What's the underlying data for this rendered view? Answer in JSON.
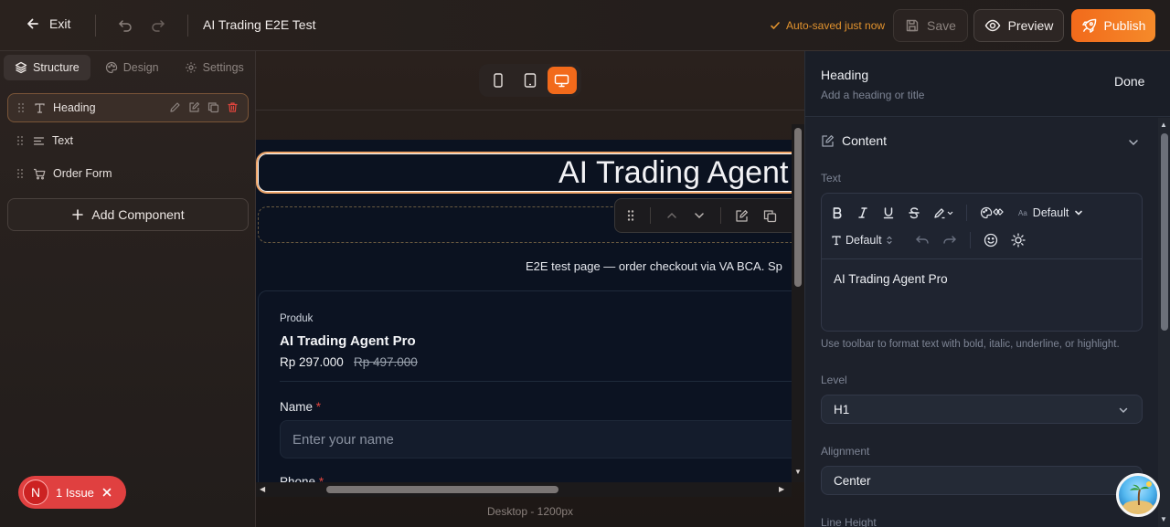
{
  "topbar": {
    "exit_label": "Exit",
    "title": "AI Trading E2E Test",
    "autosave": "Auto-saved just now",
    "save_label": "Save",
    "preview_label": "Preview",
    "publish_label": "Publish"
  },
  "left": {
    "tabs": [
      {
        "label": "Structure",
        "icon": "layers-icon",
        "active": true
      },
      {
        "label": "Design",
        "icon": "palette-icon"
      },
      {
        "label": "Settings",
        "icon": "gear-icon"
      }
    ],
    "components": [
      {
        "label": "Heading",
        "icon": "text-type-icon",
        "selected": true
      },
      {
        "label": "Text",
        "icon": "align-left-icon"
      },
      {
        "label": "Order Form",
        "icon": "cart-icon"
      }
    ],
    "add_label": "Add Component",
    "issue": {
      "avatar": "N",
      "label": "1 Issue"
    }
  },
  "canvas": {
    "devices": [
      "mobile",
      "tablet",
      "desktop"
    ],
    "active_device": "desktop",
    "heading_text": "AI Trading Agent Pro",
    "subtitle": "E2E test page — order checkout via VA BCA. Sp",
    "product_caption": "Produk",
    "product_name": "AI Trading Agent Pro",
    "price": "Rp 297.000",
    "old_price": "Rp 497.000",
    "name_label": "Name",
    "name_placeholder": "Enter your name",
    "phone_label": "Phone",
    "required_mark": "*",
    "caption": "Desktop - 1200px"
  },
  "right": {
    "title": "Heading",
    "subtitle": "Add a heading or title",
    "done_label": "Done",
    "section_label": "Content",
    "text_label": "Text",
    "font_size_label": "Default",
    "font_family_label": "Default",
    "text_value": "AI Trading Agent Pro",
    "hint": "Use toolbar to format text with bold, italic, underline, or highlight.",
    "level_label": "Level",
    "level_value": "H1",
    "alignment_label": "Alignment",
    "alignment_value": "Center",
    "line_height_label": "Line Height"
  },
  "colors": {
    "accent": "#f26a1b",
    "autosave": "#e2932e",
    "issue": "#e04040",
    "required": "#e0453d"
  }
}
